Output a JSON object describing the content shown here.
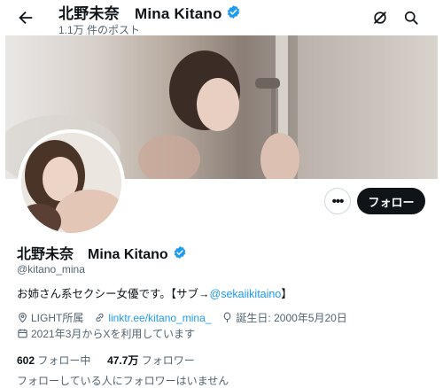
{
  "header": {
    "title": "北野未奈　Mina Kitano",
    "post_count": "1.1万 件のポスト"
  },
  "profile": {
    "display_name": "北野未奈　Mina Kitano",
    "handle": "@kitano_mina",
    "bio_text": "お姉さん系セクシー女優です。【サブ→",
    "bio_link": "@sekaiikitaino",
    "bio_end": "】",
    "location": "LIGHT所属",
    "website": "linktr.ee/kitano_mina_",
    "birthday": "誕生日: 2000年5月20日",
    "joined": "2021年3月からXを利用しています",
    "following_count": "602",
    "following_label": "フォロー中",
    "followers_count": "47.7万",
    "followers_label": "フォロワー",
    "followers_you_know": "フォローしている人にフォロワーはいません"
  },
  "actions": {
    "more_label": "•••",
    "follow_label": "フォロー"
  },
  "colors": {
    "accent": "#1d9bf0",
    "text": "#0f1419",
    "muted": "#536471"
  },
  "icons": [
    "arrow-left-icon",
    "verified-badge-icon",
    "grok-icon",
    "search-icon",
    "location-icon",
    "link-icon",
    "balloon-icon",
    "calendar-icon"
  ]
}
